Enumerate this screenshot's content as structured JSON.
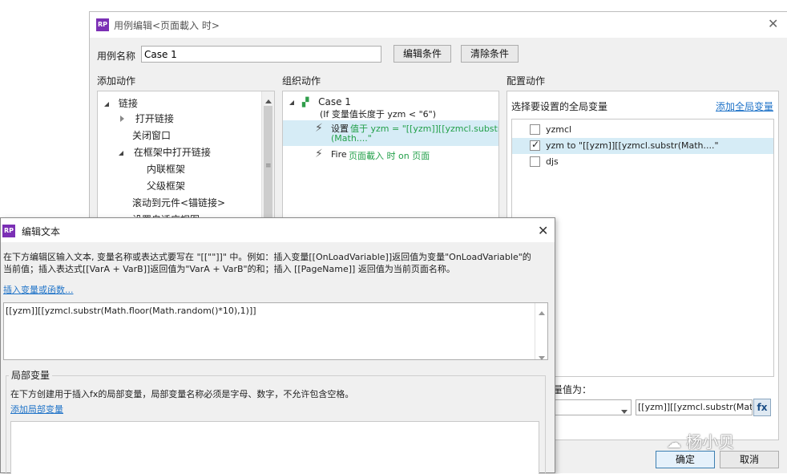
{
  "case_dialog": {
    "title": "用例编辑<页面載入 时>",
    "case_name_label": "用例名称",
    "case_name_value": "Case 1",
    "edit_condition_button": "编辑条件",
    "clear_condition_button": "清除条件",
    "add_action_header": "添加动作",
    "organize_header": "组织动作",
    "configure_header": "配置动作",
    "actions_tree": [
      "链接",
      "打开链接",
      "关闭窗口",
      "在框架中打开链接",
      "内联框架",
      "父级框架",
      "滚动到元件<锚链接>",
      "设置自适应视图"
    ],
    "organize": {
      "case_title": "Case 1",
      "case_condition": "(If 变量值长度于 yzm < \"6\")",
      "set_prefix": "设置",
      "set_detail_line1": "值于 yzm = \"[[yzm]][[yzmcl.substr",
      "set_detail_line2": "(Math....\"",
      "fire_prefix": "Fire",
      "fire_detail": "页面載入 时 on 页面"
    },
    "configure": {
      "select_label": "选择要设置的全局变量",
      "add_global_link": "添加全局变量",
      "variables": [
        {
          "label": "yzmcl",
          "checked": false
        },
        {
          "label": "yzm to \"[[yzm]][[yzmcl.substr(Math....\"",
          "checked": true
        },
        {
          "label": "djs",
          "checked": false
        }
      ],
      "set_value_label": "量值为：",
      "value_field": "[[yzm]][[yzmcl.substr(Math.flo",
      "fx_label": "fx"
    },
    "ok_button": "确定",
    "cancel_button": "取消"
  },
  "edit_text_dialog": {
    "title": "编辑文本",
    "instruction_line1": "在下方编辑区输入文本, 变量名称或表达式要写在 \"[[\"\"]]\" 中。例如：插入变量[[OnLoadVariable]]返回值为变量\"OnLoadVariable\"的",
    "instruction_line2": "当前值；插入表达式[[VarA + VarB]]返回值为\"VarA + VarB\"的和；插入 [[PageName]] 返回值为当前页面名称。",
    "insert_link": "插入变量或函数...",
    "editor_text": "[[yzm]][[yzmcl.substr(Math.floor(Math.random()*10),1)]]",
    "local_vars_title": "局部变量",
    "local_vars_desc": "在下方创建用于插入fx的局部变量，局部变量名称必须是字母、数字，不允许包含空格。",
    "add_local_link": "添加局部变量"
  },
  "watermark": "杨小贝",
  "colors": {
    "link": "#1f73c8",
    "highlight": "#d6ecf6",
    "green": "#23a04a",
    "logo": "#7b2fb5"
  }
}
